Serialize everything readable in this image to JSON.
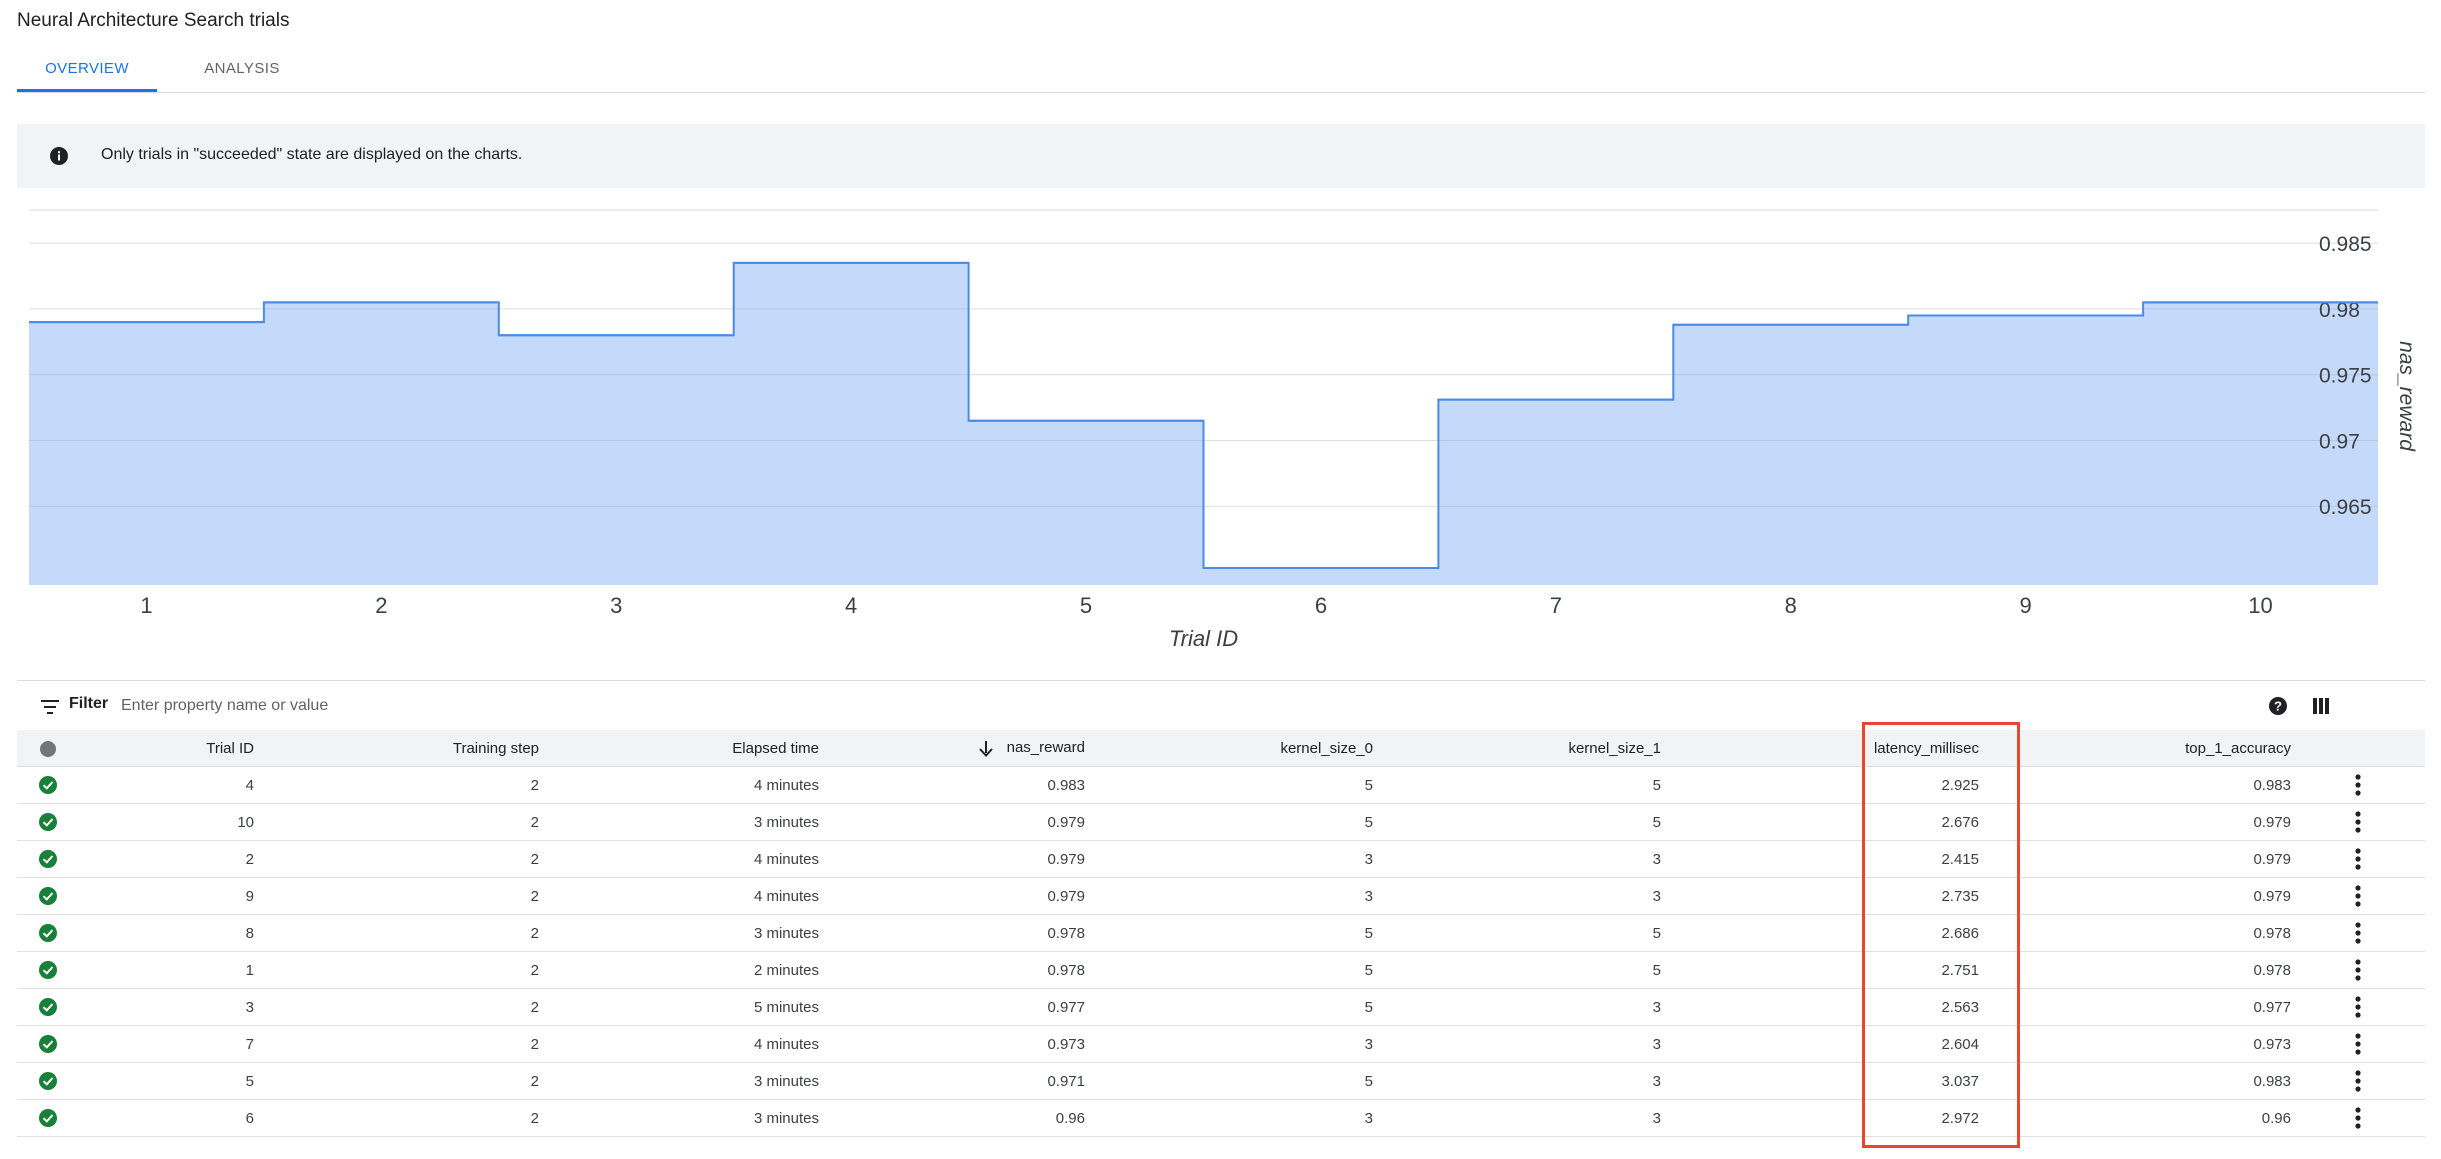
{
  "page": {
    "title": "Neural Architecture Search trials"
  },
  "tabs": [
    {
      "label": "OVERVIEW",
      "active": true
    },
    {
      "label": "ANALYSIS",
      "active": false
    }
  ],
  "banner": {
    "text": "Only trials in \"succeeded\" state are displayed on the charts.",
    "icon": "info-icon"
  },
  "chart_data": {
    "type": "area",
    "step": true,
    "x": [
      1,
      2,
      3,
      4,
      5,
      6,
      7,
      8,
      9,
      10
    ],
    "values": [
      0.979,
      0.9805,
      0.978,
      0.9835,
      0.9715,
      0.9603,
      0.9731,
      0.9788,
      0.9795,
      0.9805
    ],
    "xlabel": "Trial ID",
    "ylabel": "nas_reward",
    "y_ticks": [
      0.965,
      0.97,
      0.975,
      0.98,
      0.985
    ],
    "ylim": [
      0.96,
      0.986
    ],
    "y_axis_side": "right",
    "grid": true,
    "colors": {
      "fill": "#c5dafa",
      "line": "#4a8bea"
    }
  },
  "toolbar": {
    "filter_label": "Filter",
    "filter_placeholder": "Enter property name or value",
    "icons": [
      "filter-icon",
      "help-icon",
      "columns-icon"
    ]
  },
  "table": {
    "columns": [
      "Trial ID",
      "Training step",
      "Elapsed time",
      "nas_reward",
      "kernel_size_0",
      "kernel_size_1",
      "latency_millisec",
      "top_1_accuracy"
    ],
    "sorted_column": "nas_reward",
    "sort_direction": "descending",
    "rows": [
      [
        "4",
        "2",
        "4 minutes",
        "0.983",
        "5",
        "5",
        "2.925",
        "0.983"
      ],
      [
        "10",
        "2",
        "3 minutes",
        "0.979",
        "5",
        "5",
        "2.676",
        "0.979"
      ],
      [
        "2",
        "2",
        "4 minutes",
        "0.979",
        "3",
        "3",
        "2.415",
        "0.979"
      ],
      [
        "9",
        "2",
        "4 minutes",
        "0.979",
        "3",
        "3",
        "2.735",
        "0.979"
      ],
      [
        "8",
        "2",
        "3 minutes",
        "0.978",
        "5",
        "5",
        "2.686",
        "0.978"
      ],
      [
        "1",
        "2",
        "2 minutes",
        "0.978",
        "5",
        "5",
        "2.751",
        "0.978"
      ],
      [
        "3",
        "2",
        "5 minutes",
        "0.977",
        "5",
        "3",
        "2.563",
        "0.977"
      ],
      [
        "7",
        "2",
        "4 minutes",
        "0.973",
        "3",
        "3",
        "2.604",
        "0.973"
      ],
      [
        "5",
        "2",
        "3 minutes",
        "0.971",
        "5",
        "3",
        "3.037",
        "0.983"
      ],
      [
        "6",
        "2",
        "3 minutes",
        "0.96",
        "3",
        "3",
        "2.972",
        "0.96"
      ]
    ],
    "highlighted_column": "latency_millisec"
  },
  "colors": {
    "accent": "#1a73e8",
    "success": "#188038",
    "highlight": "#e5472f"
  }
}
